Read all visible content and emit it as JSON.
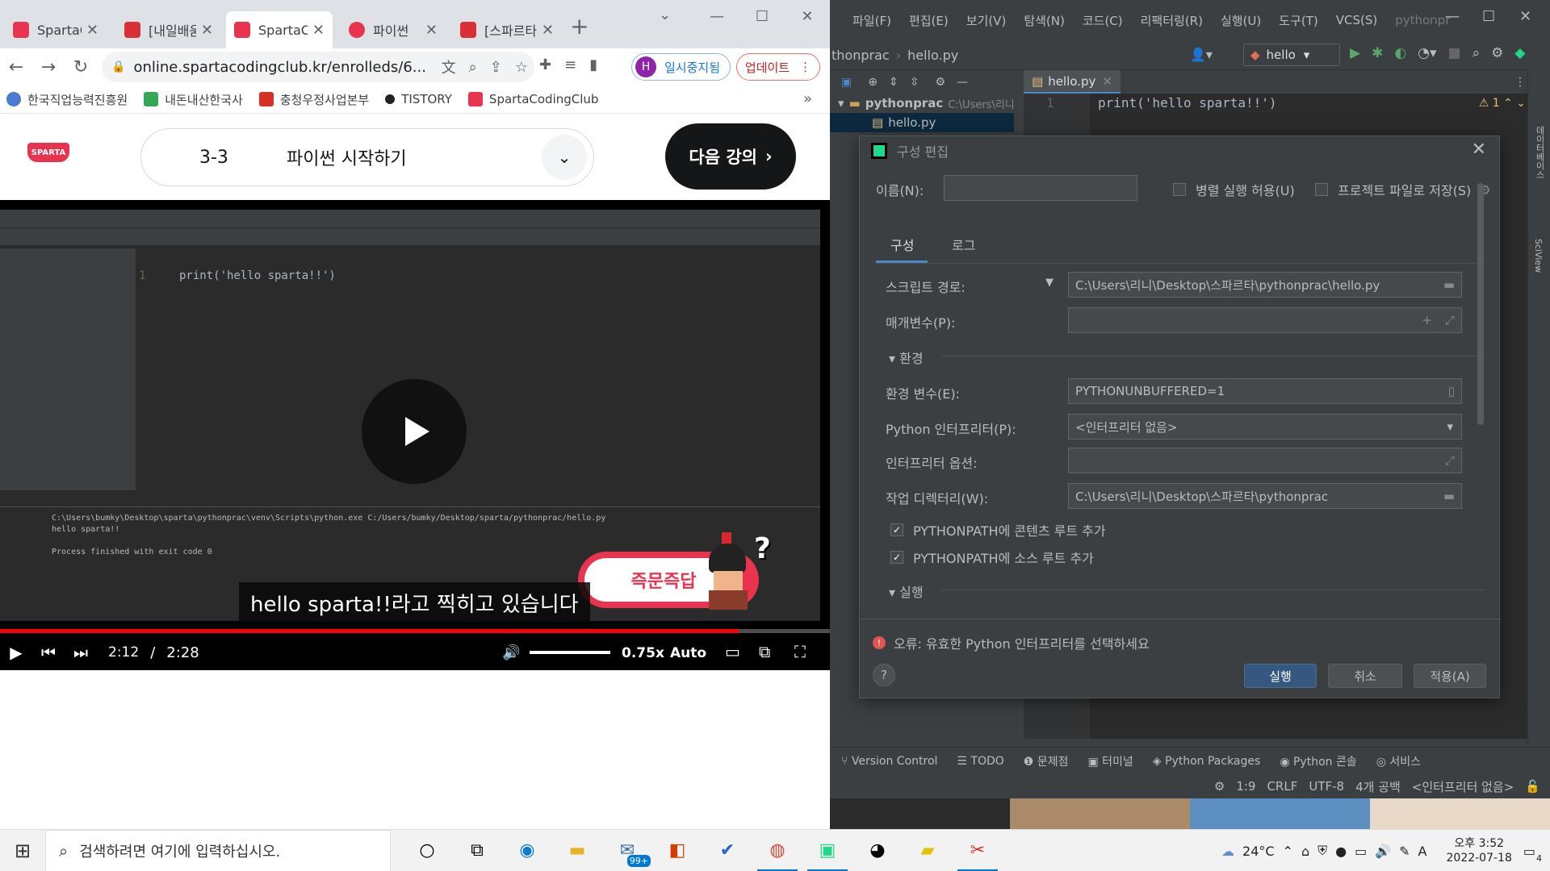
{
  "browser": {
    "tabs": [
      {
        "title": "SpartaCoding",
        "icon": "sparta-icon",
        "active": false
      },
      {
        "title": "[내일배움카드]",
        "icon": "bookmark-icon",
        "active": false
      },
      {
        "title": "SpartaCoding",
        "icon": "sparta-icon",
        "active": true
      },
      {
        "title": "파이썬",
        "icon": "heart-icon",
        "active": false
      },
      {
        "title": "[스파르타]",
        "icon": "bookmark-icon",
        "active": false
      }
    ],
    "url": "online.spartacodingclub.kr/enrolleds/6...",
    "profile_label": "일시중지됨",
    "profile_initial": "H",
    "update_label": "업데이트",
    "bookmarks": [
      "한국직업능력진흥원",
      "내돈내산한국사",
      "충청우정사업본부",
      "TISTORY",
      "SpartaCodingClub"
    ],
    "bookmarks_more": "»"
  },
  "lecture": {
    "logo": "SPARTA",
    "number": "3-3",
    "title": "파이썬 시작하기",
    "next_label": "다음 강의"
  },
  "video": {
    "inner_code": "print('hello sparta!!')",
    "inner_line": "1",
    "run_cmd": "C:\\Users\\bumky\\Desktop\\sparta\\pythonprac\\venv\\Scripts\\python.exe C:/Users/bumky/Desktop/sparta/pythonprac/hello.py",
    "run_output": "hello sparta!!",
    "run_exit": "Process finished with exit code 0",
    "subtitle": "hello sparta!!라고 찍히고 있습니다",
    "instant_label": "즉문즉답",
    "current_time": "2:12",
    "separator": "/",
    "duration": "2:28",
    "progress": 0.89,
    "volume": 1.0,
    "speed": "0.75x",
    "quality": "Auto"
  },
  "pycharm": {
    "menu": [
      "파일(F)",
      "편집(E)",
      "보기(V)",
      "탐색(N)",
      "코드(C)",
      "리팩터링(R)",
      "실행(U)",
      "도구(T)",
      "VCS(S)"
    ],
    "window_title": "pythonpr",
    "project": "thonprac",
    "file": "hello.py",
    "run_config": "hello",
    "tree_root": "pythonprac",
    "tree_root_path": "C:\\Users\\리니",
    "code_line": "print('hello sparta!!')",
    "line_number": "1",
    "warnings": "1",
    "bottom_tabs": [
      "Version Control",
      "TODO",
      "문제점",
      "터미널",
      "Python Packages",
      "Python 콘솔",
      "서비스"
    ],
    "status": {
      "position": "1:9",
      "line_sep": "CRLF",
      "encoding": "UTF-8",
      "indent": "4개 공백",
      "interpreter": "<인터프리터 없음>"
    },
    "right_strip": [
      "데이터베이스",
      "SciView"
    ]
  },
  "dialog": {
    "title": "구성 편집",
    "name_label": "이름(N):",
    "name_value": "",
    "parallel_label": "병렬 실행 허용(U)",
    "save_label": "프로젝트 파일로 저장(S)",
    "tab_config": "구성",
    "tab_log": "로그",
    "script_label": "스크립트 경로:",
    "script_value": "C:\\Users\\리니\\Desktop\\스파르타\\pythonprac\\hello.py",
    "params_label": "매개변수(P):",
    "env_section": "환경",
    "env_vars_label": "환경 변수(E):",
    "env_vars_value": "PYTHONUNBUFFERED=1",
    "interpreter_label": "Python 인터프리터(P):",
    "interpreter_value": "<인터프리터 없음>",
    "interp_opts_label": "인터프리터 옵션:",
    "workdir_label": "작업 디렉터리(W):",
    "workdir_value": "C:\\Users\\리니\\Desktop\\스파르타\\pythonprac",
    "content_roots_label": "PYTHONPATH에 콘텐츠 루트 추가",
    "content_roots_checked": true,
    "source_roots_label": "PYTHONPATH에 소스 루트 추가",
    "source_roots_checked": true,
    "exec_section": "실행",
    "error_text": "오류: 유효한 Python 인터프리터를 선택하세요",
    "run_label": "실행",
    "cancel_label": "취소",
    "apply_label": "적용(A)",
    "help_label": "?"
  },
  "taskbar": {
    "search_placeholder": "검색하려면 여기에 입력하십시오.",
    "mail_badge": "99+",
    "weather": "24°C",
    "time": "오후 3:52",
    "date": "2022-07-18",
    "notifications": "4",
    "ime": "A"
  },
  "colors": {
    "sparta_red": "#e8344e",
    "pycharm_bg": "#3c3f41",
    "editor_bg": "#2b2b2b",
    "primary_button": "#365880",
    "error_red": "#e05555"
  }
}
